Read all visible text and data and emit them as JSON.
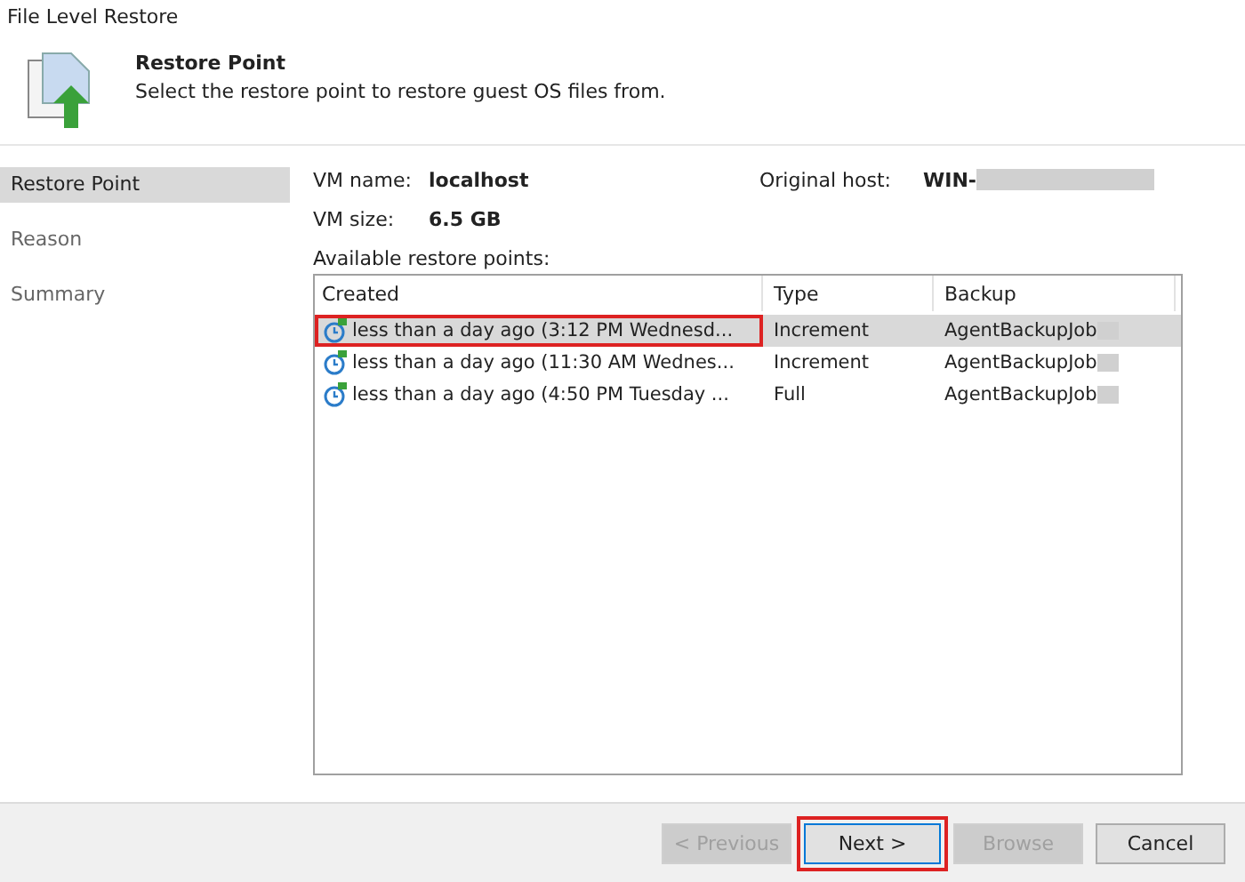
{
  "window": {
    "title": "File Level Restore"
  },
  "header": {
    "title": "Restore Point",
    "subtitle": "Select the restore point to restore guest OS files from."
  },
  "sidebar": {
    "items": [
      {
        "label": "Restore Point",
        "selected": true
      },
      {
        "label": "Reason",
        "selected": false
      },
      {
        "label": "Summary",
        "selected": false
      }
    ]
  },
  "vm_info": {
    "name_label": "VM name:",
    "name": "localhost",
    "host_label": "Original host:",
    "host": "WIN-",
    "size_label": "VM size:",
    "size": "6.5 GB"
  },
  "table": {
    "caption": "Available restore points:",
    "columns": [
      "Created",
      "Type",
      "Backup"
    ],
    "rows": [
      {
        "created": "less than a day ago (3:12 PM Wednesd...",
        "type": "Increment",
        "backup": "AgentBackupJob",
        "selected": true,
        "highlighted": true
      },
      {
        "created": "less than a day ago (11:30 AM Wednes...",
        "type": "Increment",
        "backup": "AgentBackupJob",
        "selected": false,
        "highlighted": false
      },
      {
        "created": "less than a day ago (4:50 PM Tuesday ...",
        "type": "Full",
        "backup": "AgentBackupJob",
        "selected": false,
        "highlighted": false
      }
    ]
  },
  "buttons": [
    {
      "label": "< Previous",
      "disabled": true,
      "highlighted": false
    },
    {
      "label": "Next >",
      "disabled": false,
      "highlighted": true
    },
    {
      "label": "Browse",
      "disabled": true,
      "highlighted": false
    },
    {
      "label": "Cancel",
      "disabled": false,
      "highlighted": false
    }
  ]
}
